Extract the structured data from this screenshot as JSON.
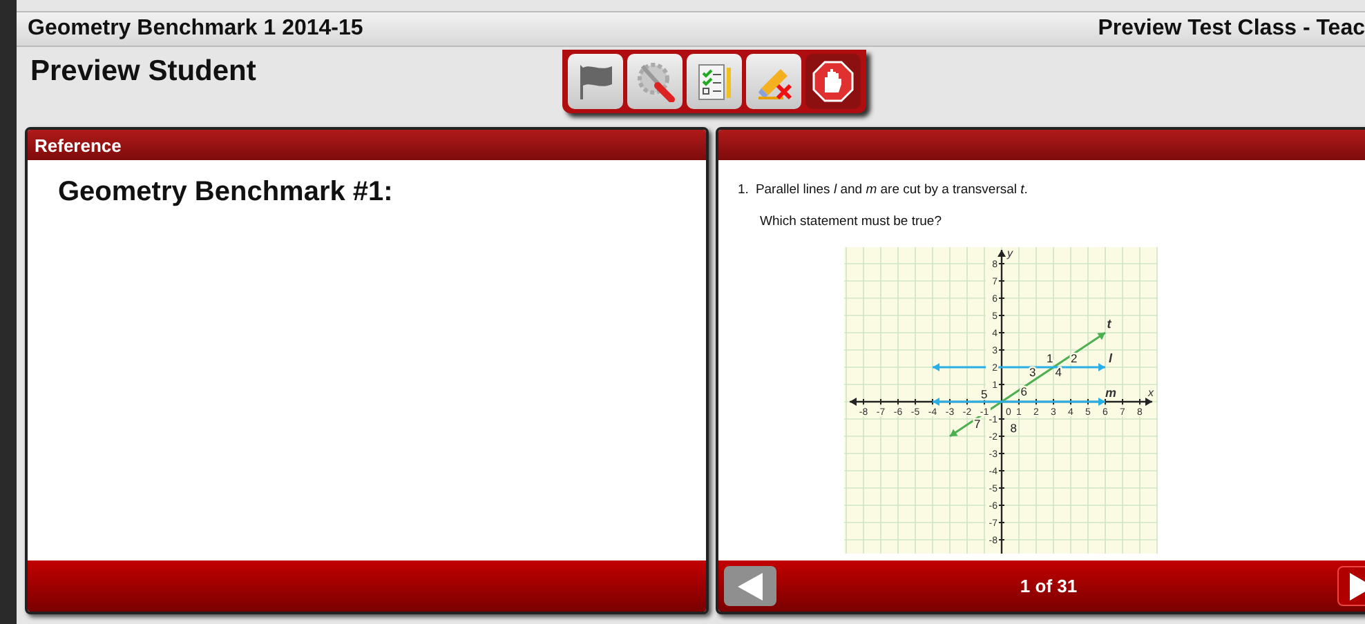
{
  "header": {
    "test_title": "Geometry Benchmark 1 2014-15",
    "class_name": "Preview Test Class - Teac"
  },
  "student": "Preview Student",
  "tools": [
    {
      "kind": "flag"
    },
    {
      "kind": "tools"
    },
    {
      "kind": "checklist"
    },
    {
      "kind": "eraser"
    },
    {
      "kind": "stop"
    }
  ],
  "reference_panel": {
    "title": "Reference",
    "heading": "Geometry Benchmark #1:"
  },
  "question_panel": {
    "number": "1.",
    "prompt": "Parallel lines *l* and *m* are cut by a transversal *t*.",
    "question": "Which statement must be true?",
    "graph": {
      "x_axis": "x",
      "y_axis": "y",
      "origin": "0",
      "x_ticks": [
        "-8",
        "-7",
        "-6",
        "-5",
        "-4",
        "-3",
        "-2",
        "-1",
        "1",
        "2",
        "3",
        "4",
        "5",
        "6",
        "7",
        "8"
      ],
      "y_ticks": [
        "8",
        "7",
        "6",
        "5",
        "4",
        "3",
        "2",
        "1",
        "-1",
        "-2",
        "-3",
        "-4",
        "-5",
        "-6",
        "-7",
        "-8"
      ],
      "lines": [
        {
          "label": "t",
          "color": "#4caf50"
        },
        {
          "label": "l",
          "color": "#29aee6"
        },
        {
          "label": "m",
          "color": "#29aee6"
        }
      ],
      "angle_labels": [
        "1",
        "2",
        "3",
        "4",
        "5",
        "6",
        "7",
        "8"
      ]
    }
  },
  "pager": {
    "position": "1 of 31"
  }
}
